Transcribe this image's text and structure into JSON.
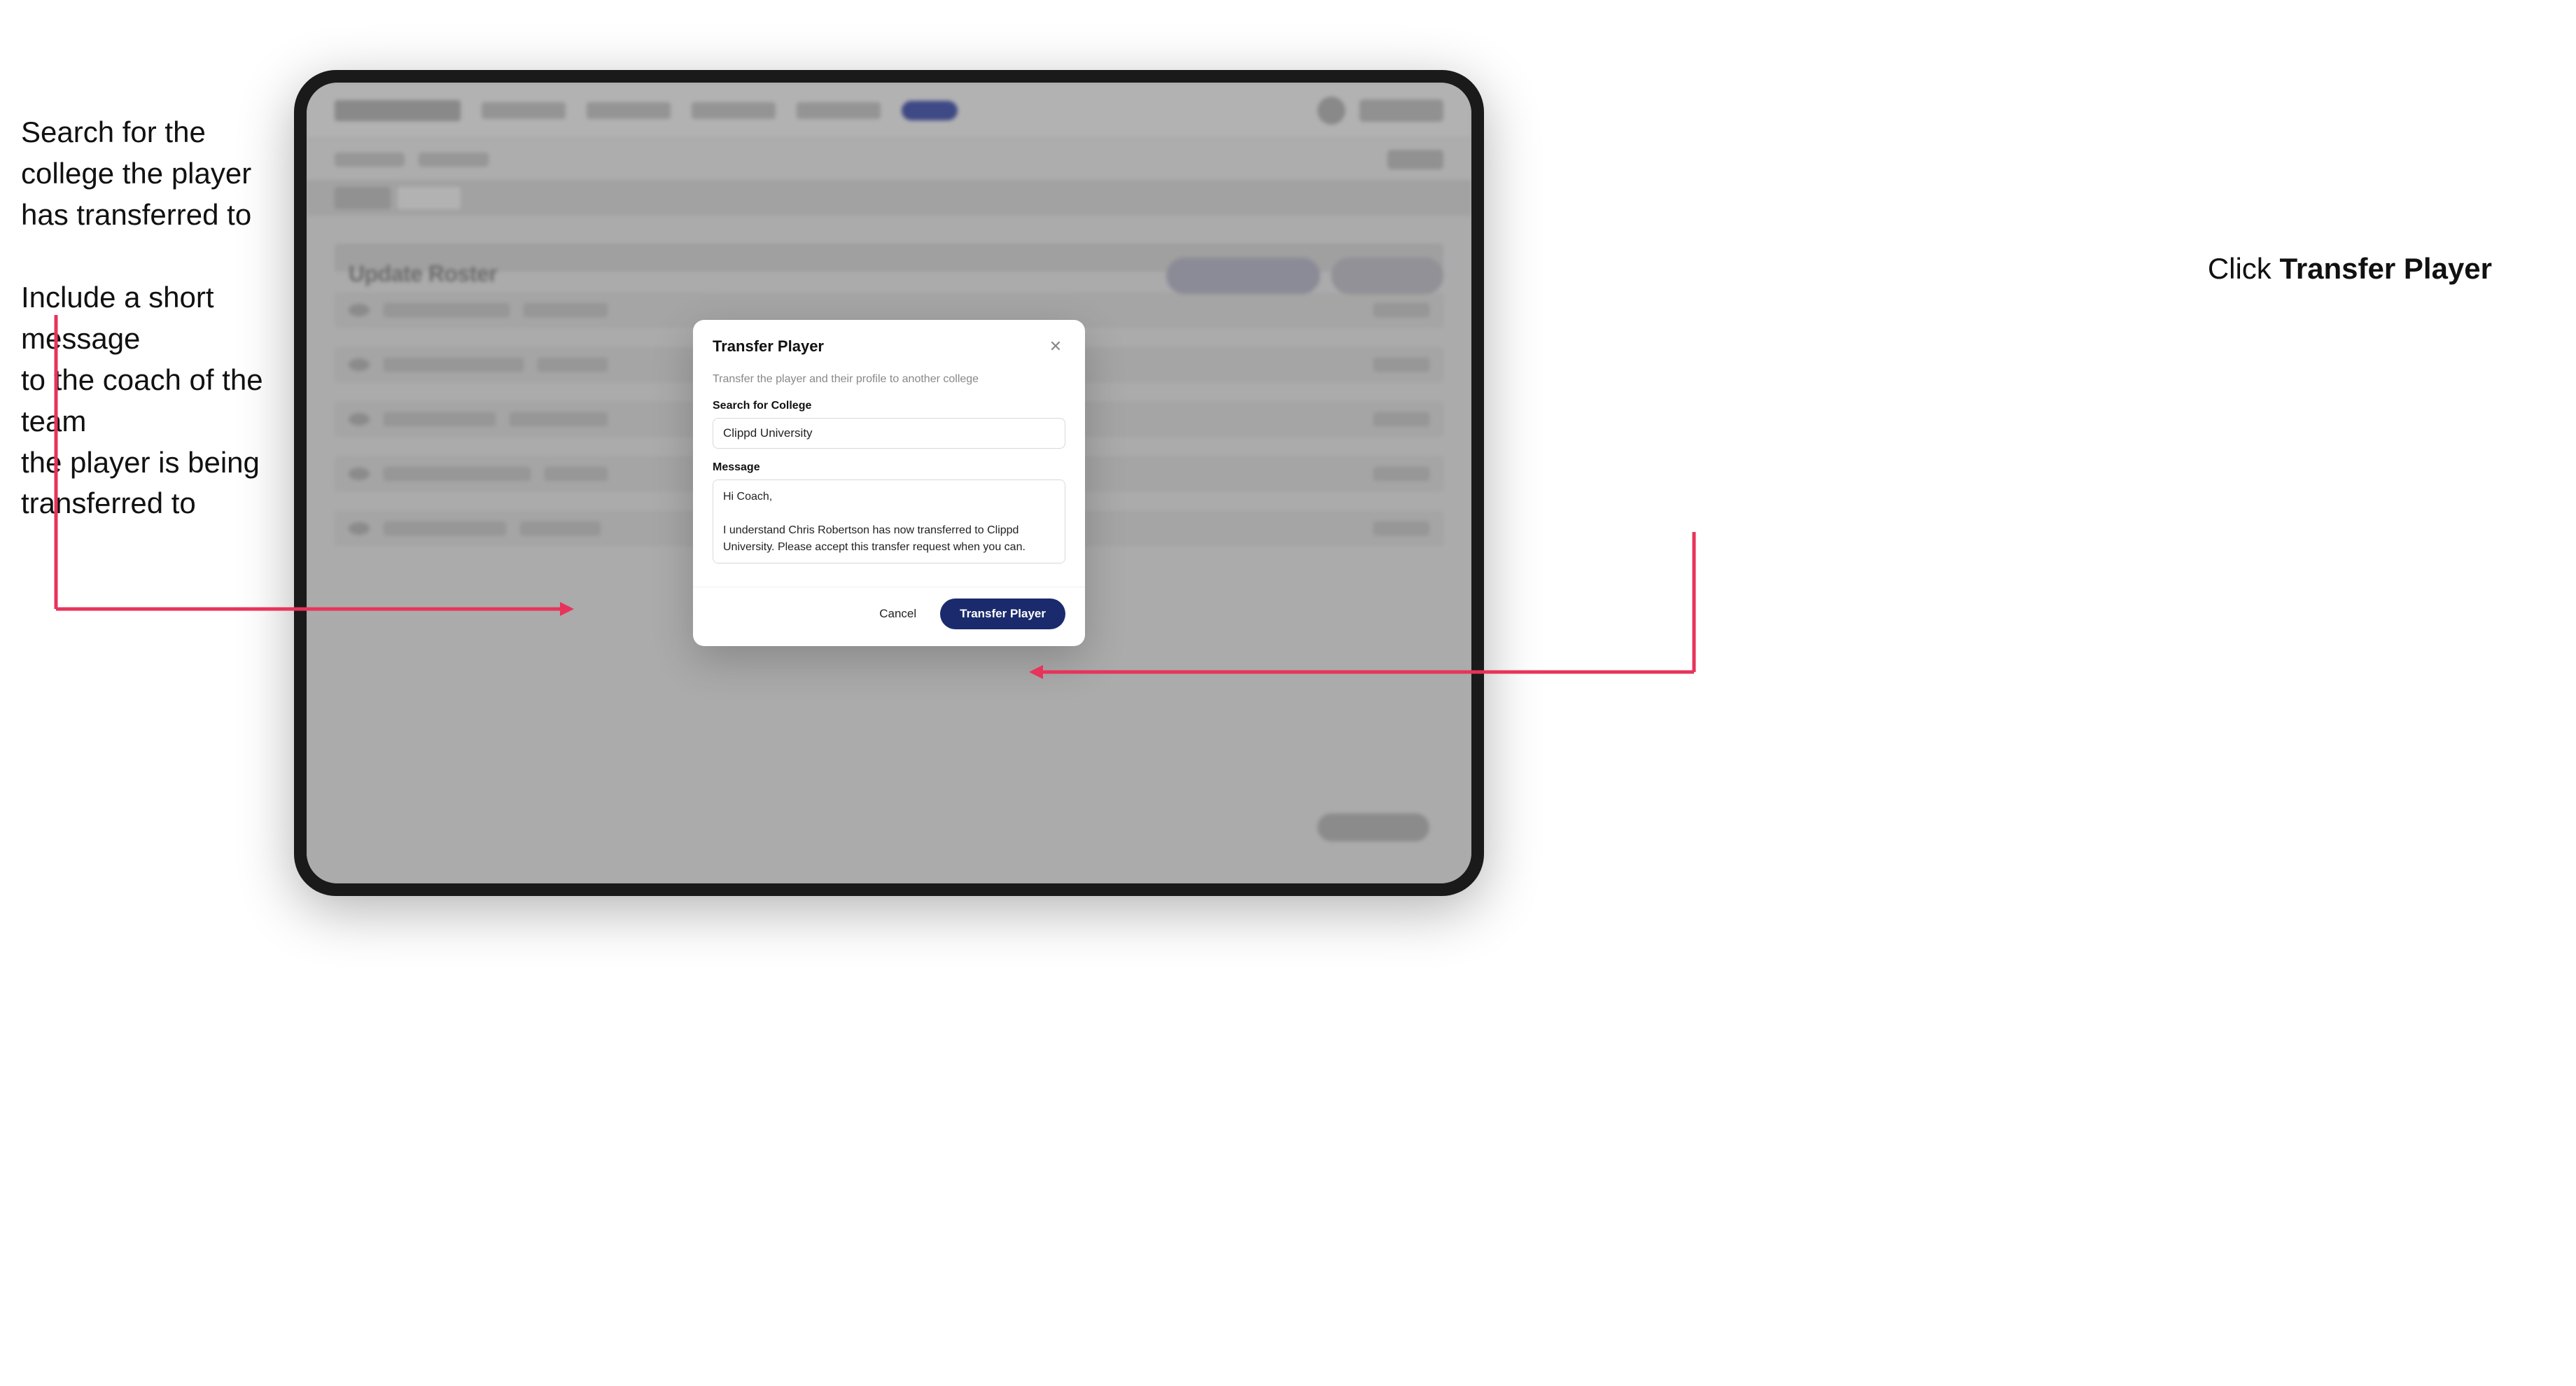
{
  "annotations": {
    "left_top": "Search for the college the player has transferred to",
    "left_bottom": "Include a short message\nto the coach of the team\nthe player is being\ntransferred to",
    "right": "Click Transfer Player"
  },
  "modal": {
    "title": "Transfer Player",
    "description": "Transfer the player and their profile to another college",
    "search_label": "Search for College",
    "search_value": "Clippd University",
    "message_label": "Message",
    "message_value": "Hi Coach,\n\nI understand Chris Robertson has now transferred to Clippd University. Please accept this transfer request when you can.",
    "cancel_label": "Cancel",
    "transfer_label": "Transfer Player"
  },
  "bg": {
    "section_title": "Update Roster"
  }
}
